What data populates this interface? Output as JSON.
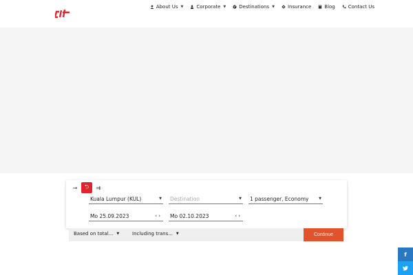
{
  "header": {
    "nav": [
      {
        "label": "About Us",
        "icon": "user-group-icon",
        "has_caret": true
      },
      {
        "label": "Corporate",
        "icon": "people-icon",
        "has_caret": true
      },
      {
        "label": "Destinations",
        "icon": "globe-icon",
        "has_caret": true
      },
      {
        "label": "Insurance",
        "icon": "shield-icon",
        "has_caret": false
      },
      {
        "label": "Blog",
        "icon": "book-icon",
        "has_caret": false
      },
      {
        "label": "Contact Us",
        "icon": "phone-icon",
        "has_caret": false
      }
    ]
  },
  "search": {
    "origin": "Kuala Lumpur (KUL)",
    "destination_placeholder": "Destination",
    "passengers": "1 passenger, Economy",
    "depart_date": "Mo 25.09.2023",
    "return_date": "Mo 02.10.2023",
    "fare_option": "Based on total...",
    "transfer_option": "Including trans...",
    "continue_label": "Continue"
  },
  "colors": {
    "brand_red": "#e0242e",
    "continue_orange": "#e0532c",
    "facebook_blue": "#2b78c2",
    "twitter_blue": "#1da1f2"
  }
}
